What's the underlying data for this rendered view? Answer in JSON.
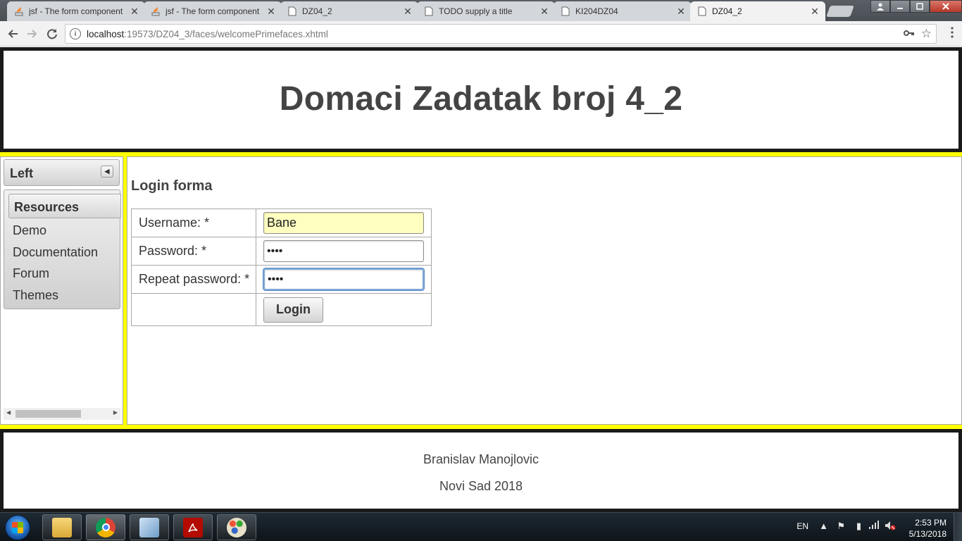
{
  "browser": {
    "tabs": [
      {
        "title": "jsf - The form component",
        "icon": "stackoverflow-icon",
        "active": false
      },
      {
        "title": "jsf - The form component",
        "icon": "stackoverflow-icon",
        "active": false
      },
      {
        "title": "DZ04_2",
        "icon": "page-icon",
        "active": false
      },
      {
        "title": "TODO supply a title",
        "icon": "page-icon",
        "active": false
      },
      {
        "title": "KI204DZ04",
        "icon": "page-icon",
        "active": false
      },
      {
        "title": "DZ04_2",
        "icon": "page-icon",
        "active": true
      }
    ],
    "close_glyph": "✕",
    "url_host": "localhost",
    "url_rest": ":19573/DZ04_3/faces/welcomePrimefaces.xhtml"
  },
  "header": {
    "title": "Domaci Zadatak broj 4_2"
  },
  "west": {
    "title": "Left",
    "menu_title": "Resources",
    "items": [
      "Demo",
      "Documentation",
      "Forum",
      "Themes"
    ]
  },
  "form": {
    "title": "Login forma",
    "username_label": "Username:  *",
    "username_value": "Bane",
    "password_label": "Password:  *",
    "password_value": "••••",
    "repeat_label": "Repeat password:  *",
    "repeat_value": "••••",
    "login_label": "Login"
  },
  "footer": {
    "line1": "Branislav Manojlovic",
    "line2": "Novi Sad 2018"
  },
  "taskbar": {
    "lang": "EN",
    "time": "2:53 PM",
    "date": "5/13/2018"
  },
  "colors": {
    "layout_background": "#ffff00",
    "filled_input": "#ffffc0"
  }
}
